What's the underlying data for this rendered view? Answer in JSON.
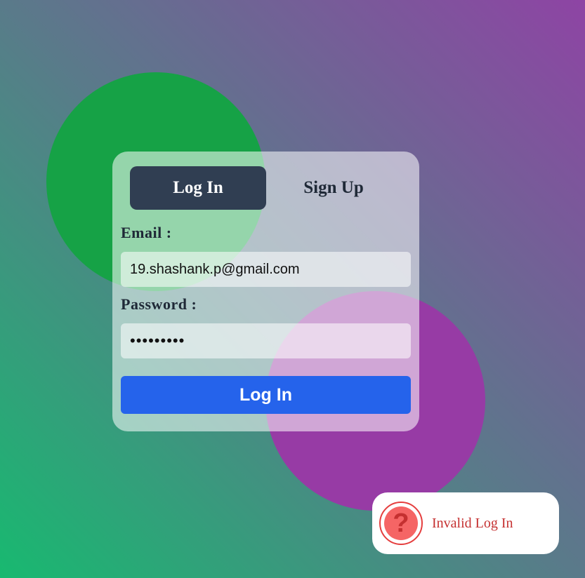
{
  "tabs": {
    "login_label": "Log In",
    "signup_label": "Sign Up"
  },
  "form": {
    "email_label": "Email :",
    "email_value": "19.shashank.p@gmail.com",
    "password_label": "Password :",
    "password_value": "•••••••••",
    "submit_label": "Log In"
  },
  "toast": {
    "icon": "question-circle-icon",
    "glyph": "?",
    "message": "Invalid Log In"
  },
  "colors": {
    "tab_active": "#303e52",
    "submit": "#2563eb",
    "toast_text": "#c53030",
    "blob_green": "#16a246",
    "blob_purple": "#973ba5"
  }
}
